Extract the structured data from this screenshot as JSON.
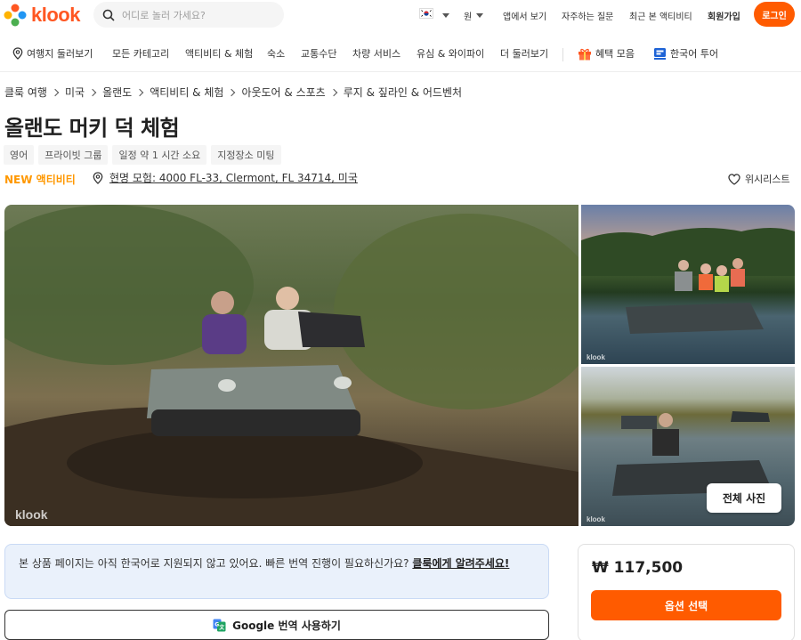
{
  "brand": {
    "name": "klook",
    "color": "#ff5722"
  },
  "header": {
    "search_placeholder": "어디로 놀러 가세요?",
    "language_icon": "korea-flag-icon",
    "currency": "원",
    "nav": [
      "앱에서 보기",
      "자주하는 질문",
      "최근 본 액티비티",
      "회원가입"
    ],
    "login_label": "로그인"
  },
  "categories": {
    "items": [
      "여행지 둘러보기",
      "모든 카테고리",
      "액티비티 & 체험",
      "숙소",
      "교통수단",
      "차량 서비스",
      "유심 & 와이파이",
      "더 둘러보기"
    ],
    "promo_label": "혜택 모음",
    "tour_label": "한국어 투어"
  },
  "breadcrumb": [
    "클룩 여행",
    "미국",
    "올랜도",
    "액티비티 & 체험",
    "아웃도어 & 스포츠",
    "루지 & 짚라인 & 어드벤처"
  ],
  "product": {
    "title": "올랜도 머키 덕 체험",
    "tags": [
      "영어",
      "프라이빗 그룹",
      "일정 약 1 시간  소요",
      "지정장소 미팅"
    ],
    "badge": "NEW 액티비티",
    "address": "현명 모험: 4000 FL-33, Clermont, FL 34714, 미국",
    "wishlist_label": "위시리스트"
  },
  "gallery": {
    "watermark": "klook",
    "all_photos_label": "전체 사진"
  },
  "notice": {
    "text": "본 상품 페이지는 아직 한국어로 지원되지 않고 있어요. 빠른 번역 진행이 필요하신가요? ",
    "link_label": "클룩에게 알려주세요!",
    "translate_label": "Google 번역 사용하기"
  },
  "booking": {
    "price": "₩ 117,500",
    "select_label": "옵션 선택",
    "accent": "#ff5b00"
  }
}
